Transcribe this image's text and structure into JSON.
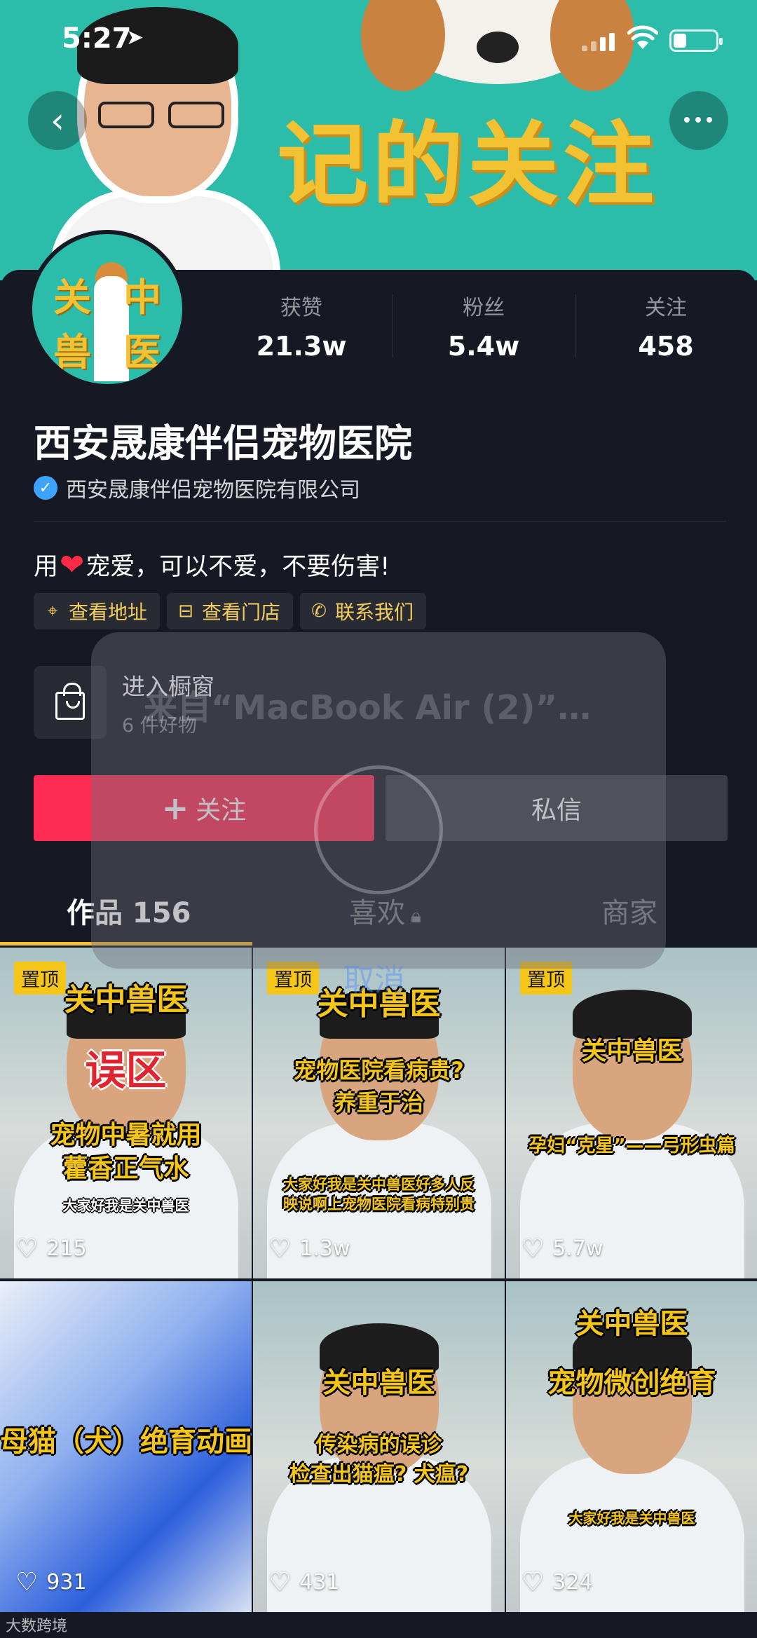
{
  "status_bar": {
    "time": "5:27"
  },
  "banner": {
    "text": "记的关注"
  },
  "nav": {
    "back_icon": "‹",
    "more_icon": "•••"
  },
  "avatar": {
    "chars": [
      "关",
      "中",
      "兽",
      "医"
    ]
  },
  "stats": [
    {
      "label": "获赞",
      "value": "21.3w"
    },
    {
      "label": "粉丝",
      "value": "5.4w"
    },
    {
      "label": "关注",
      "value": "458"
    }
  ],
  "profile": {
    "name": "西安晟康伴侣宠物医院",
    "verified_org": "西安晟康伴侣宠物医院有限公司",
    "bio_prefix": "用",
    "bio_suffix": "宠爱，可以不爱，不要伤害!"
  },
  "tags": [
    {
      "icon": "location-pin-icon",
      "label": "查看地址"
    },
    {
      "icon": "store-icon",
      "label": "查看门店"
    },
    {
      "icon": "phone-icon",
      "label": "联系我们"
    }
  ],
  "shop": {
    "title": "进入橱窗",
    "subtitle": "6 件好物"
  },
  "buttons": {
    "follow": "关注",
    "message": "私信"
  },
  "tabs": {
    "works": "作品 156",
    "likes": "喜欢",
    "shop": "商家"
  },
  "overlay": {
    "title": "来自“MacBook Air (2)”…",
    "cancel": "取消"
  },
  "videos": [
    {
      "pinned": "置顶",
      "captions": [
        "关中兽医",
        "误区",
        "宠物中暑就用",
        "藿香正气水",
        "大家好我是关中兽医"
      ],
      "likes": "215"
    },
    {
      "pinned": "置顶",
      "captions": [
        "关中兽医",
        "宠物医院看病贵?",
        "养重于治",
        "大家好我是关中兽医好多人反",
        "映说啊上宠物医院看病特别贵"
      ],
      "likes": "1.3w"
    },
    {
      "pinned": "置顶",
      "captions": [
        "关中兽医",
        "孕妇“克星”——弓形虫篇"
      ],
      "likes": "5.7w"
    },
    {
      "pinned": "",
      "captions": [
        "母猫（犬）绝育动画"
      ],
      "likes": "931"
    },
    {
      "pinned": "",
      "captions": [
        "关中兽医",
        "传染病的误诊",
        "检查出猫瘟? 犬瘟?"
      ],
      "likes": "431"
    },
    {
      "pinned": "",
      "captions": [
        "关中兽医",
        "宠物微创绝育",
        "大家好我是关中兽医"
      ],
      "likes": "324"
    }
  ],
  "watermark": "大数跨境",
  "colors": {
    "accent_red": "#fe2c55",
    "pin_yellow": "#f5c518",
    "background": "#161823",
    "tag_text": "#f5cd5c"
  }
}
